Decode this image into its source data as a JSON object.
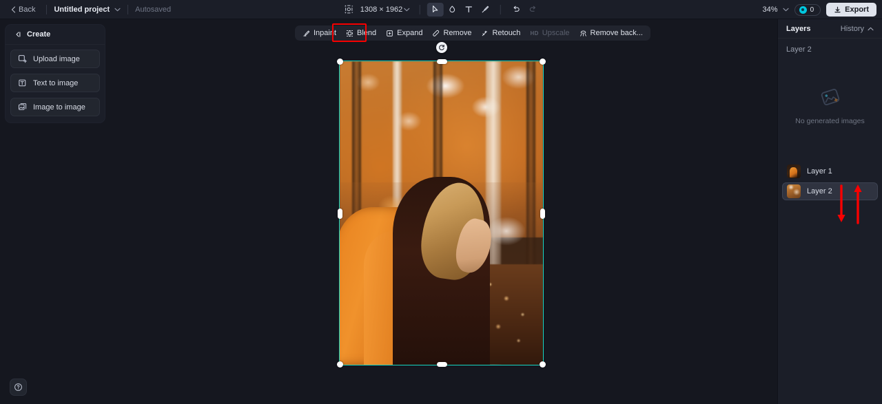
{
  "topbar": {
    "back_label": "Back",
    "project_name": "Untitled project",
    "autosaved_label": "Autosaved",
    "dimensions": "1308 × 1962",
    "zoom_level": "34%",
    "credits_count": "0",
    "export_label": "Export",
    "tools": [
      {
        "name": "frame-icon",
        "label": "Frame"
      },
      {
        "name": "select-tool",
        "label": "Select",
        "active": true
      },
      {
        "name": "mask-tool",
        "label": "Mask"
      },
      {
        "name": "text-tool",
        "label": "Text"
      },
      {
        "name": "brush-tool",
        "label": "Brush"
      },
      {
        "name": "undo-button",
        "label": "Undo"
      },
      {
        "name": "redo-button",
        "label": "Redo"
      }
    ]
  },
  "create_panel": {
    "title": "Create",
    "items": [
      {
        "label": "Upload image",
        "icon": "upload-image-icon"
      },
      {
        "label": "Text to image",
        "icon": "text-to-image-icon"
      },
      {
        "label": "Image to image",
        "icon": "image-to-image-icon"
      }
    ]
  },
  "edit_toolbar": {
    "items": [
      {
        "label": "Inpaint",
        "icon": "inpaint-icon",
        "disabled": false,
        "highlighted": false
      },
      {
        "label": "Blend",
        "icon": "blend-icon",
        "disabled": false,
        "highlighted": true
      },
      {
        "label": "Expand",
        "icon": "expand-icon",
        "disabled": false,
        "highlighted": false
      },
      {
        "label": "Remove",
        "icon": "remove-icon",
        "disabled": false,
        "highlighted": false
      },
      {
        "label": "Retouch",
        "icon": "retouch-icon",
        "disabled": false,
        "highlighted": false
      },
      {
        "label": "Upscale",
        "badge": "HD",
        "icon": "upscale-icon",
        "disabled": true,
        "highlighted": false
      },
      {
        "label": "Remove back...",
        "icon": "remove-background-icon",
        "disabled": false,
        "highlighted": false
      }
    ],
    "highlight_color": "#f80000"
  },
  "canvas": {
    "selection_color": "#17d7c4",
    "image_description": "Woman in orange coat in autumn birch forest"
  },
  "right_panel": {
    "tab_layers": "Layers",
    "tab_history": "History",
    "current_layer_label": "Layer 2",
    "empty_state_label": "No generated images",
    "layers": [
      {
        "name": "Layer 1",
        "selected": false
      },
      {
        "name": "Layer 2",
        "selected": true
      }
    ],
    "annotation_color": "#f80000"
  },
  "help": {
    "label": "?"
  }
}
